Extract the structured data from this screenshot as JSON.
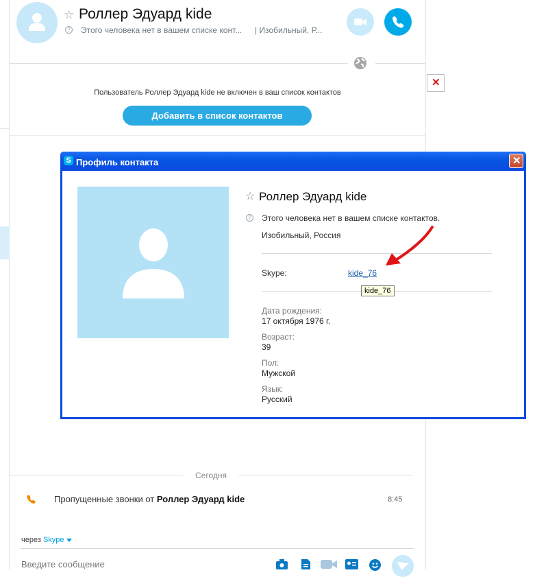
{
  "conversation": {
    "contact_name": "Роллер Эдуард kide",
    "status_text": "Этого человека нет в вашем списке конт...",
    "location_text": "|  Изобильный, Р...",
    "icons": {
      "avatar": "person-icon",
      "favorite": "star-icon",
      "info": "question-icon",
      "video": "video-call-icon",
      "call": "phone-icon",
      "globe": "globe-icon"
    }
  },
  "notice": {
    "text": "Пользователь Роллер Эдуард kide не включен в ваш список контактов",
    "add_button": "Добавить в список контактов"
  },
  "close_icon": "close-icon",
  "dialog": {
    "title": "Профиль контакта",
    "app_icon_letter": "S",
    "contact_name": "Роллер Эдуард kide",
    "status_text": "Этого человека нет в вашем списке контактов.",
    "location": "Изобильный, Россия",
    "skype_label": "Skype:",
    "skype_id": "kide_76",
    "tooltip": "kide_76",
    "fields": {
      "birthday_label": "Дата рождения:",
      "birthday_value": "17 октября 1976 г.",
      "age_label": "Возраст:",
      "age_value": "39",
      "gender_label": "Пол:",
      "gender_value": "Мужской",
      "language_label": "Язык:",
      "language_value": "Русский"
    },
    "annotation": "red-arrow"
  },
  "timeline": {
    "day_label": "Сегодня",
    "missed_prefix": "Пропущенные звонки от ",
    "missed_name": "Роллер Эдуард kide",
    "missed_time": "8:45"
  },
  "compose": {
    "via_prefix": "через ",
    "via_service": "Skype",
    "placeholder": "Введите сообщение",
    "tools": [
      "camera-icon",
      "file-icon",
      "video-message-icon",
      "contact-card-icon",
      "emoticon-icon",
      "send-icon"
    ]
  },
  "colors": {
    "skype_blue": "#00a9e8",
    "avatar_bg": "#c7e8f8",
    "xp_title": "#0a4ae0",
    "link": "#1a5fa8",
    "arrow": "#e01515"
  }
}
